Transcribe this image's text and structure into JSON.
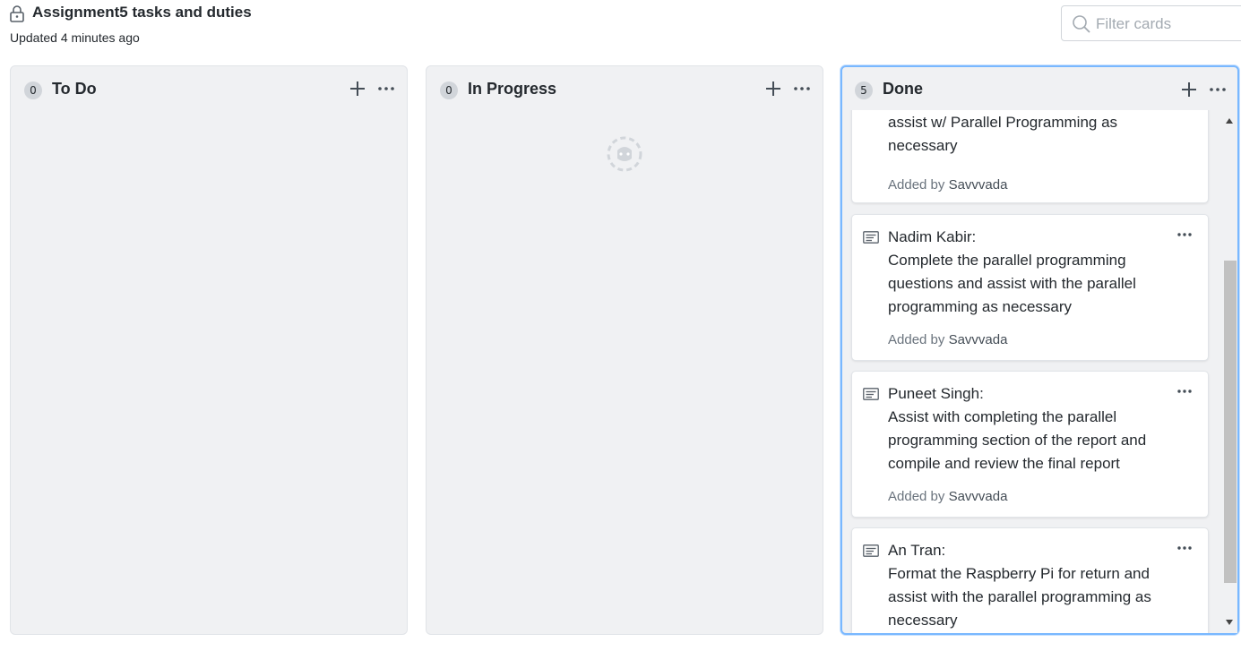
{
  "project": {
    "title": "Assignment5 tasks and duties",
    "updated": "Updated 4 minutes ago",
    "lock_icon": "lock-icon"
  },
  "filter": {
    "placeholder": "Filter cards",
    "icon": "search-icon"
  },
  "columns": [
    {
      "name": "To Do",
      "count": "0"
    },
    {
      "name": "In Progress",
      "count": "0",
      "loading": true
    },
    {
      "name": "Done",
      "count": "5"
    }
  ],
  "cards": [
    {
      "text": "assist w/ Parallel Programming as necessary",
      "added_prefix": "Added by",
      "added_user": "Savvvada"
    },
    {
      "text": "Nadim Kabir:\nComplete the parallel programming questions and assist with the parallel programming as necessary",
      "added_prefix": "Added by",
      "added_user": "Savvvada"
    },
    {
      "text": "Puneet Singh:\nAssist with completing the parallel programming section of the report and compile and review the final report",
      "added_prefix": "Added by",
      "added_user": "Savvvada"
    },
    {
      "text": "An Tran:\nFormat the Raspberry Pi for return and assist with the parallel programming as necessary",
      "added_prefix": "",
      "added_user": ""
    }
  ],
  "colors": {
    "column_bg": "#f0f1f3",
    "active_border": "#79b8ff",
    "muted_text": "#6a737d"
  }
}
